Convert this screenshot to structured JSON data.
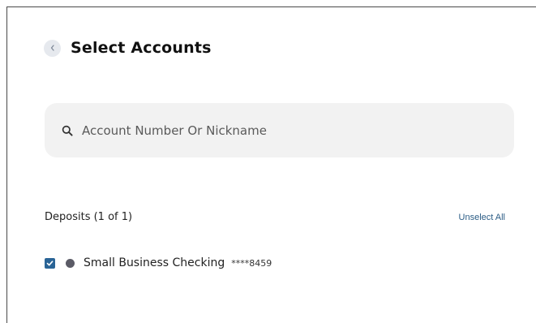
{
  "header": {
    "title": "Select Accounts",
    "back_icon": "chevron-left-icon"
  },
  "search": {
    "placeholder": "Account Number Or Nickname",
    "value": "",
    "icon": "search-icon"
  },
  "deposits": {
    "title": "Deposits (1 of 1)",
    "unselect_label": "Unselect All",
    "accounts": [
      {
        "name": "Small Business Checking",
        "mask": "****8459",
        "checked": true,
        "dot_color": "#5b5b66"
      }
    ]
  },
  "colors": {
    "accent": "#2a6496",
    "link": "#2c5d86",
    "search_bg": "#f2f2f2"
  }
}
